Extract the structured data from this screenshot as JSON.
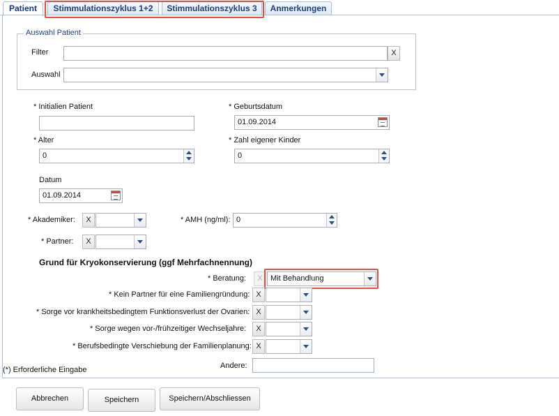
{
  "tabs": [
    "Patient",
    "Stimmulationszyklus 1+2",
    "Stimmulationszyklus 3",
    "Anmerkungen"
  ],
  "auswahl_patient": {
    "legend": "Auswahl Patient",
    "filter_label": "Filter",
    "filter_value": "",
    "clear": "X",
    "auswahl_label": "Auswahl",
    "auswahl_value": ""
  },
  "fields": {
    "initialen_label": "* Initialien Patient",
    "initialen_value": "",
    "geburtsdatum_label": "* Geburtsdatum",
    "geburtsdatum_value": "01.09.2014",
    "alter_label": "* Alter",
    "alter_value": "0",
    "kinder_label": "* Zahl eigener Kinder",
    "kinder_value": "0",
    "datum_label": "Datum",
    "datum_value": "01.09.2014",
    "akademiker_label": "* Akademiker:",
    "akademiker_value": "",
    "amh_label": "* AMH (ng/ml):",
    "amh_value": "0",
    "partner_label": "* Partner:",
    "partner_value": ""
  },
  "grund": {
    "heading": "Grund für Kryokonservierung (ggf Mehrfachnennung)",
    "beratung_label": "* Beratung:",
    "beratung_value": "Mit Behandlung",
    "kein_partner_label": "* Kein Partner für eine Familiengründung:",
    "ovarien_label": "* Sorge vor krankheitsbedingtem Funktionsverlust der Ovarien:",
    "wechseljahre_label": "* Sorge wegen vor-/frühzeitiger Wechseljahre:",
    "beruf_label": "* Berufsbedingte Verschiebung der Familienplanung:",
    "andere_label": "Andere:",
    "andere_value": ""
  },
  "footnote": "(*) Erforderliche Eingabe",
  "buttons": {
    "abbrechen": "Abbrechen",
    "speichern": "Speichern",
    "speichern_abschliessen": "Speichern/Abschliessen"
  },
  "colors": {
    "highlight": "#e8503d",
    "tab_text": "#1f3f7a",
    "border": "#a9bfd6"
  }
}
